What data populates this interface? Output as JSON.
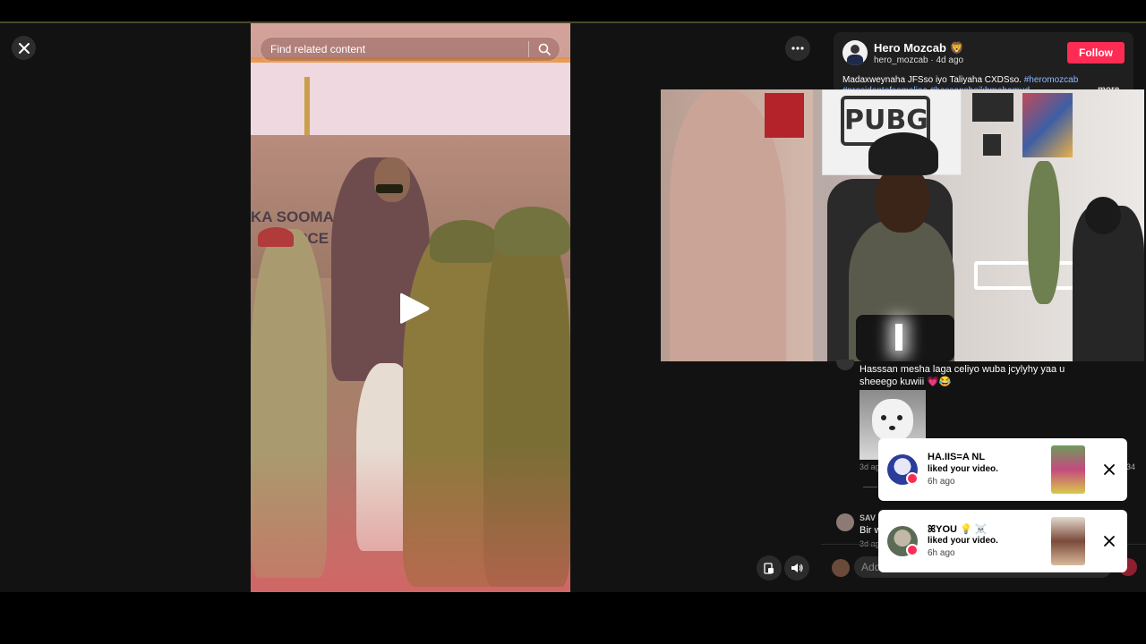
{
  "video": {
    "search_placeholder": "Find related content",
    "banner_text": "KA SOOMAA",
    "banner_text2": "ORCE"
  },
  "creator": {
    "name": "Hero Mozcab",
    "name_emoji": "🦁",
    "handle_line": "hero_mozcab · 4d ago",
    "follow_label": "Follow",
    "caption": "Madaxweynaha JFSso iyo Taliyaha CXDSso.",
    "caption_tag": "#heromozcab",
    "caption_line2": "#presidentofsomaliaa #hassansheikhmohamud",
    "more_label": "more"
  },
  "comment": {
    "text": "Hasssan mesha laga celiyo wuba jcylyhy yaa u sheeego kuwiii",
    "emoji": "💗😂",
    "age": "3d ag",
    "likes": "34",
    "second_author": "SAV",
    "second_text": "Bir w",
    "second_age": "3d ag"
  },
  "input": {
    "placeholder": "Add"
  },
  "notifications": [
    {
      "name": "HA.IIS=A NL",
      "message": "liked your video.",
      "time": "6h ago"
    },
    {
      "name": "ꕤYOU 💡 ☠️",
      "message": "liked your video.",
      "time": "6h ago"
    }
  ],
  "colors": {
    "accent": "#fe2c55",
    "tag": "#8fb8ff"
  },
  "icons": [
    "close-icon",
    "search-icon",
    "play-icon",
    "more-icon",
    "miniplayer-icon",
    "volume-icon",
    "heart-icon"
  ]
}
